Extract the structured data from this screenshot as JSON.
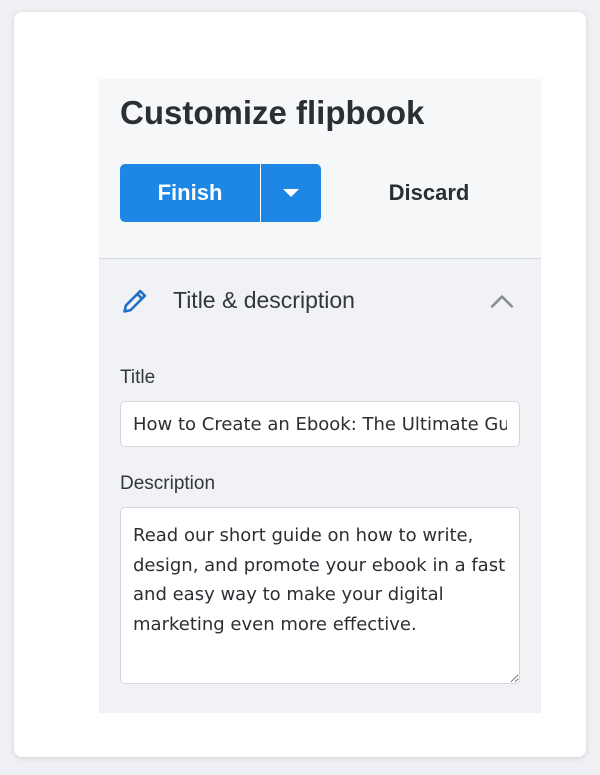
{
  "page_title": "Customize flipbook",
  "actions": {
    "finish_label": "Finish",
    "discard_label": "Discard",
    "dropdown_icon": "caret-down-icon"
  },
  "section": {
    "title": "Title & description",
    "icon": "pencil-icon",
    "collapse_icon": "chevron-up-icon",
    "expanded": true
  },
  "fields": {
    "title_label": "Title",
    "title_value": "How to Create an Ebook: The Ultimate Guide",
    "description_label": "Description",
    "description_value": "Read our short guide on how to write, design, and promote your ebook in a fast and easy way to make your digital marketing even more effective."
  },
  "colors": {
    "accent": "#1e87e5",
    "panel_bg": "#f1f2f5",
    "pencil_icon": "#1e6fc7",
    "text": "#2b2e33"
  }
}
